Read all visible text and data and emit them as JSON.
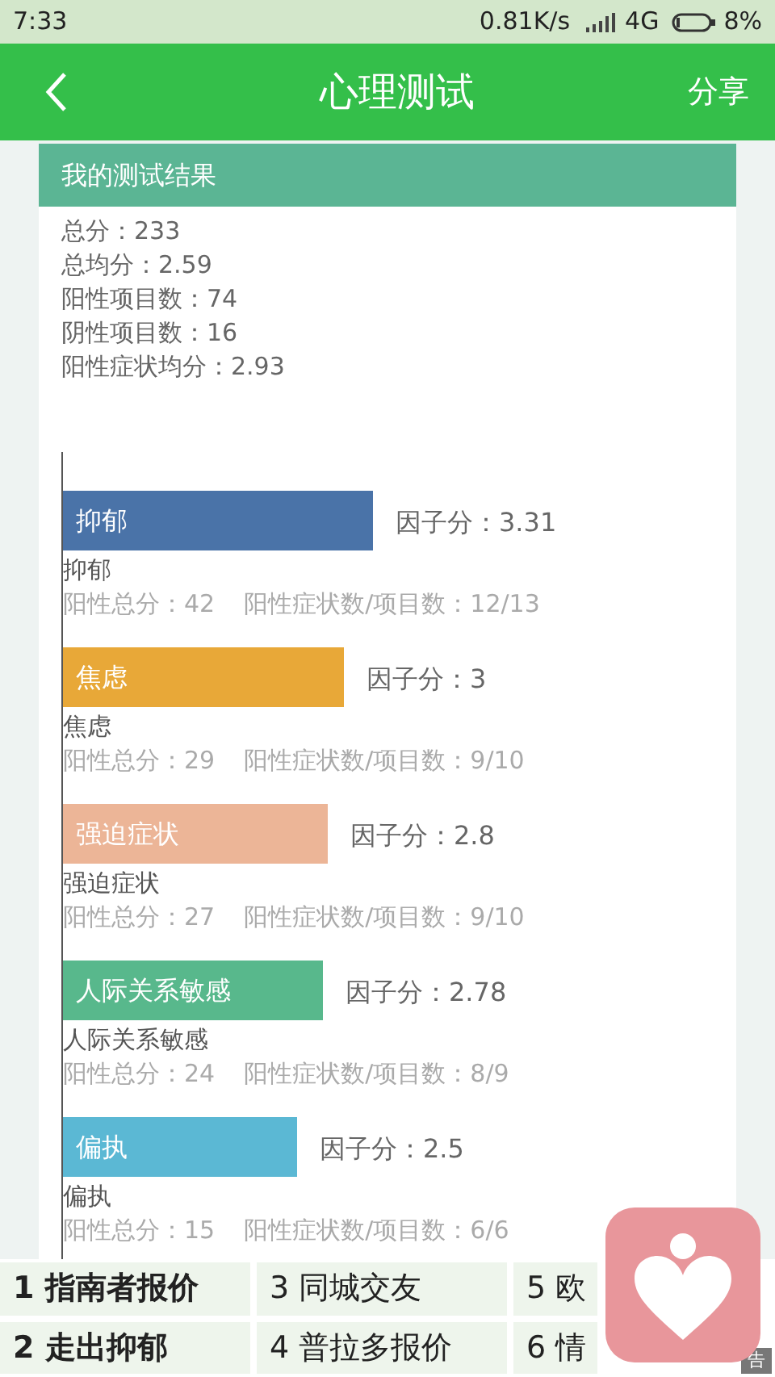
{
  "status_bar": {
    "time": "7:33",
    "speed": "0.81K/s",
    "network": "4G",
    "battery": "8%"
  },
  "header": {
    "title": "心理测试",
    "action": "分享"
  },
  "card": {
    "title": "我的测试结果",
    "summary": [
      "总分：233",
      "总均分：2.59",
      "阳性项目数：74",
      "阴性项目数：16",
      "阳性症状均分：2.93"
    ],
    "factors": [
      {
        "name": "抑郁",
        "color": "#4a73a8",
        "score": "因子分：3.31",
        "label": "抑郁",
        "total": "阳性总分：42",
        "ratio": "阳性症状数/项目数：12/13"
      },
      {
        "name": "焦虑",
        "color": "#e8a838",
        "score": "因子分：3",
        "label": "焦虑",
        "total": "阳性总分：29",
        "ratio": "阳性症状数/项目数：9/10"
      },
      {
        "name": "强迫症状",
        "color": "#ecb597",
        "score": "因子分：2.8",
        "label": "强迫症状",
        "total": "阳性总分：27",
        "ratio": "阳性症状数/项目数：9/10"
      },
      {
        "name": "人际关系敏感",
        "color": "#58b88c",
        "score": "因子分：2.78",
        "label": "人际关系敏感",
        "total": "阳性总分：24",
        "ratio": "阳性症状数/项目数：8/9"
      },
      {
        "name": "偏执",
        "color": "#5bb8d4",
        "score": "因子分：2.5",
        "label": "偏执",
        "total": "阳性总分：15",
        "ratio": "阳性症状数/项目数：6/6"
      }
    ]
  },
  "ad_links": [
    {
      "text": "1 指南者报价",
      "bold": true
    },
    {
      "text": "3 同城交友",
      "bold": false
    },
    {
      "text": "5 欧",
      "bold": false
    },
    {
      "text": "2 走出抑郁",
      "bold": true
    },
    {
      "text": "4 普拉多报价",
      "bold": false
    },
    {
      "text": "6 情",
      "bold": false
    }
  ],
  "ad_tag": "告"
}
